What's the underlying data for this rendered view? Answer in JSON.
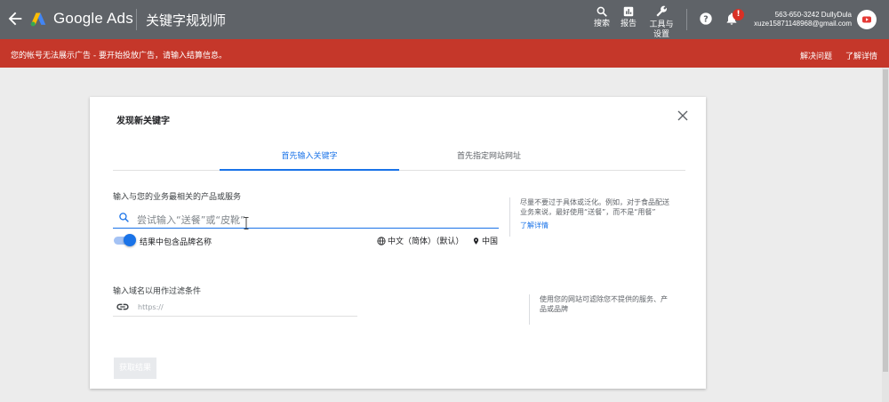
{
  "header": {
    "brand": "Google Ads",
    "tool_title": "关键字规划师",
    "actions": [
      {
        "label": "搜索",
        "icon": "search-icon"
      },
      {
        "label": "报告",
        "icon": "reports-icon"
      },
      {
        "label_line1": "工具与",
        "label_line2": "设置",
        "icon": "wrench-icon"
      }
    ],
    "notification_count": "!",
    "account": {
      "line1": "563-650-3242 DullyDula",
      "line2": "xuze15871148968@gmail.com"
    }
  },
  "alert": {
    "message": "您的帐号无法展示广告 - 要开始投放广告，请输入结算信息。",
    "fix_link": "解决问题",
    "details_link": "了解详情",
    "color": "#c5372a"
  },
  "dialog": {
    "title": "发现新关键字",
    "tabs": [
      {
        "label": "首先输入关键字",
        "active": true
      },
      {
        "label": "首先指定网站网址",
        "active": false
      }
    ],
    "product_label": "输入与您的业务最相关的产品或服务",
    "search_placeholder": "尝试输入“送餐”或“皮靴”",
    "brand_toggle_label": "结果中包含品牌名称",
    "language": "中文（简体）（默认）",
    "location": "中国",
    "hint1": {
      "line1": "尽量不要过于具体或泛化。例如，对于食品配送",
      "line2": "业务来说，最好使用“送餐”，而不是“用餐”",
      "link": "了解详情"
    },
    "domain_label": "输入域名以用作过滤条件",
    "url_placeholder": "https://",
    "hint2": {
      "line1": "使用您的网站可滤除您不提供的服务、产",
      "line2": "品或品牌"
    },
    "submit_label": "获取结果"
  },
  "colors": {
    "topbar": "#5f6368",
    "accent": "#1a73e8"
  }
}
